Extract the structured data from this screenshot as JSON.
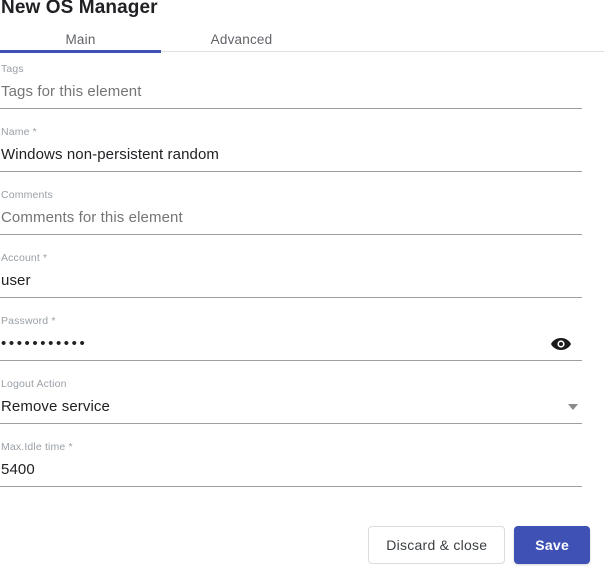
{
  "dialog": {
    "title": "New OS Manager"
  },
  "tabs": {
    "items": [
      {
        "label": "Main",
        "active": true
      },
      {
        "label": "Advanced",
        "active": false
      }
    ]
  },
  "form": {
    "fields": [
      {
        "label": "Tags",
        "value": "",
        "placeholder": "Tags for this element",
        "type": "text"
      },
      {
        "label": "Name *",
        "value": "Windows non-persistent random",
        "placeholder": "",
        "type": "text"
      },
      {
        "label": "Comments",
        "value": "",
        "placeholder": "Comments for this element",
        "type": "text"
      },
      {
        "label": "Account *",
        "value": "user",
        "placeholder": "",
        "type": "text"
      },
      {
        "label": "Password *",
        "value": "•••••••••••",
        "placeholder": "",
        "type": "password",
        "masked_length": 11,
        "toggle_icon": "eye-icon"
      },
      {
        "label": "Logout Action",
        "value": "Remove service",
        "placeholder": "",
        "type": "select",
        "dropdown_icon": "chevron-down-icon"
      },
      {
        "label": "Max.Idle time *",
        "value": "5400",
        "placeholder": "",
        "type": "text"
      }
    ]
  },
  "footer": {
    "discard_label": "Discard & close",
    "save_label": "Save"
  },
  "colors": {
    "accent": "#3f51b5",
    "label": "#9aa0a6",
    "value": "#202124",
    "placeholder": "#b6b8bb",
    "underline": "#9e9e9e"
  }
}
